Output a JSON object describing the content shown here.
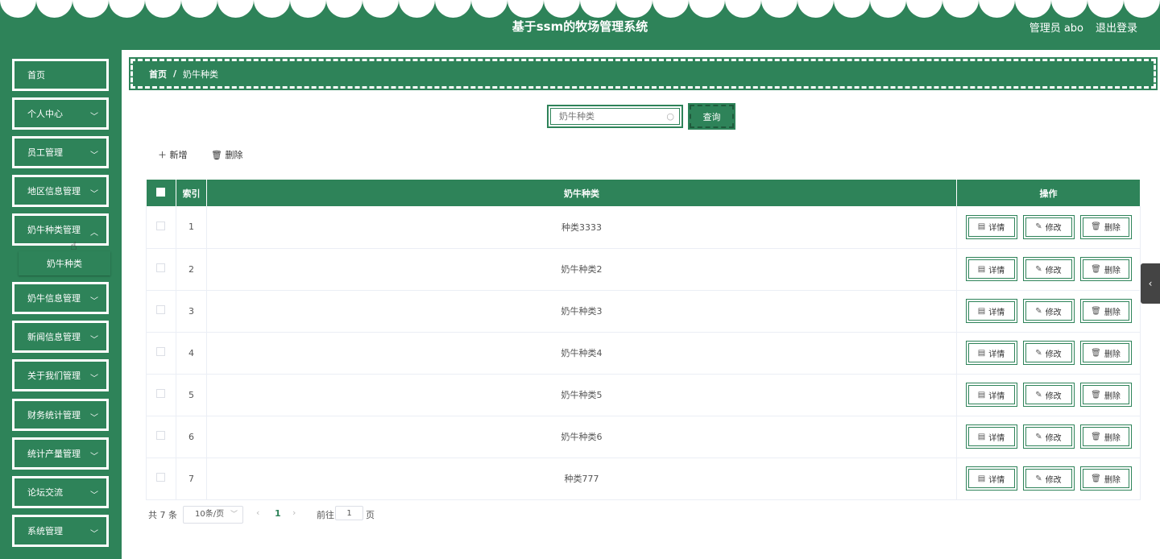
{
  "header": {
    "title": "基于ssm的牧场管理系统",
    "user": "管理员 abo",
    "logout": "退出登录"
  },
  "sidebar": {
    "items": [
      {
        "label": "首页",
        "has_children": false
      },
      {
        "label": "个人中心",
        "has_children": true
      },
      {
        "label": "员工管理",
        "has_children": true
      },
      {
        "label": "地区信息管理",
        "has_children": true
      },
      {
        "label": "奶牛种类管理",
        "has_children": true,
        "expanded": true
      },
      {
        "label": "奶牛信息管理",
        "has_children": true
      },
      {
        "label": "新闻信息管理",
        "has_children": true
      },
      {
        "label": "关于我们管理",
        "has_children": true
      },
      {
        "label": "财务统计管理",
        "has_children": true
      },
      {
        "label": "统计产量管理",
        "has_children": true
      },
      {
        "label": "论坛交流",
        "has_children": true
      },
      {
        "label": "系统管理",
        "has_children": true
      }
    ],
    "sub_item": "奶牛种类"
  },
  "breadcrumb": {
    "home": "首页",
    "separator": "/",
    "current": "奶牛种类"
  },
  "search": {
    "placeholder": "奶牛种类",
    "button": "查询"
  },
  "actions": {
    "add": "新增",
    "delete": "删除"
  },
  "table": {
    "columns": [
      "索引",
      "奶牛种类",
      "操作"
    ],
    "rows": [
      {
        "index": "1",
        "type": "种类3333"
      },
      {
        "index": "2",
        "type": "奶牛种类2"
      },
      {
        "index": "3",
        "type": "奶牛种类3"
      },
      {
        "index": "4",
        "type": "奶牛种类4"
      },
      {
        "index": "5",
        "type": "奶牛种类5"
      },
      {
        "index": "6",
        "type": "奶牛种类6"
      },
      {
        "index": "7",
        "type": "种类777"
      }
    ],
    "op_labels": {
      "detail": "详情",
      "edit": "修改",
      "delete": "删除"
    }
  },
  "pagination": {
    "total": "共 7 条",
    "page_size": "10条/页",
    "current_page": "1",
    "goto_prefix": "前往",
    "goto_value": "1",
    "goto_suffix": "页"
  },
  "colors": {
    "primary": "#2e8359",
    "white": "#ffffff"
  }
}
